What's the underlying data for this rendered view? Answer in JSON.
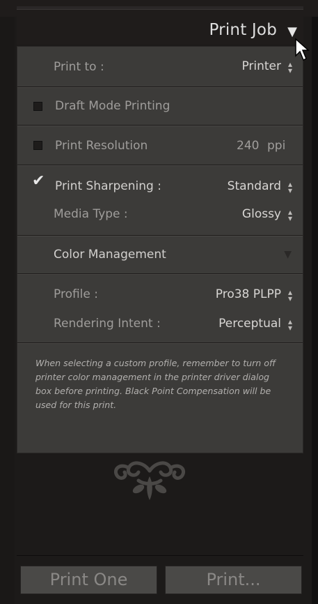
{
  "header": {
    "title": "Print Job",
    "toggle_icon": "triangle-down-icon"
  },
  "print_to": {
    "label": "Print to :",
    "value": "Printer"
  },
  "draft_mode": {
    "label": "Draft Mode Printing",
    "checked": false
  },
  "resolution": {
    "label": "Print Resolution",
    "value": "240",
    "unit": "ppi",
    "checked": false
  },
  "sharpening": {
    "label": "Print Sharpening :",
    "value": "Standard",
    "checked": true
  },
  "media_type": {
    "label": "Media Type :",
    "value": "Glossy"
  },
  "color_management": {
    "title": "Color Management",
    "profile": {
      "label": "Profile :",
      "value": "Pro38 PLPP"
    },
    "rendering_intent": {
      "label": "Rendering Intent :",
      "value": "Perceptual"
    },
    "note": "When selecting a custom profile, remember to turn off printer color management in the printer driver dialog box before printing. Black Point Compensation will be used for this print."
  },
  "buttons": {
    "print_one": "Print One",
    "print": "Print..."
  },
  "colors": {
    "panel": "#3c3b39",
    "background": "#1c1a19",
    "button": "#4a4947"
  }
}
